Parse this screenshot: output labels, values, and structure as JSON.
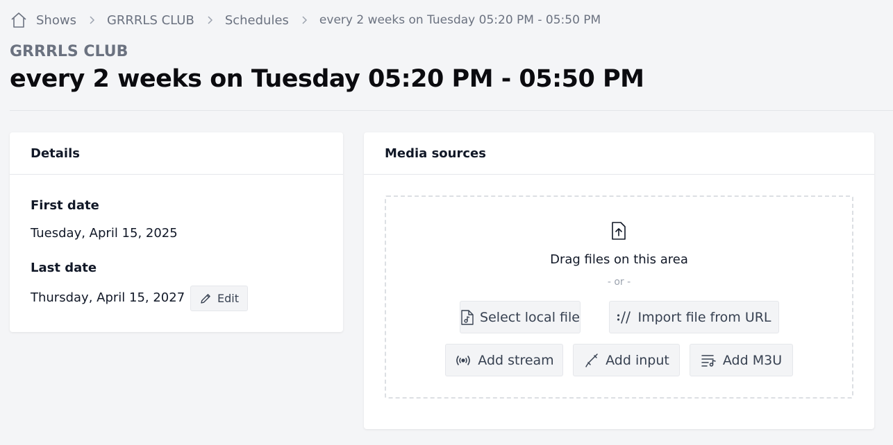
{
  "breadcrumb": {
    "items": [
      "Shows",
      "GRRRLS CLUB",
      "Schedules",
      "every 2 weeks on Tuesday 05:20 PM - 05:50 PM"
    ]
  },
  "header": {
    "show_name": "GRRRLS CLUB",
    "title": "every 2 weeks on Tuesday 05:20 PM - 05:50 PM"
  },
  "details": {
    "heading": "Details",
    "first_date_label": "First date",
    "first_date_value": "Tuesday, April 15, 2025",
    "last_date_label": "Last date",
    "last_date_value": "Thursday, April 15, 2027",
    "edit_label": "Edit"
  },
  "media": {
    "heading": "Media sources",
    "drag_text": "Drag files on this area",
    "or_text": "- or -",
    "select_local_label": "Select local file",
    "import_url_label": "Import file from URL",
    "add_stream_label": "Add stream",
    "add_input_label": "Add input",
    "add_m3u_label": "Add M3U"
  },
  "icons": {
    "home": "home-icon",
    "chevron": "chevron-right-icon",
    "upload": "file-upload-icon",
    "pencil": "pencil-icon",
    "audio_file": "audio-file-icon",
    "url": "url-slashes-icon",
    "stream": "broadcast-icon",
    "input": "audio-cable-icon",
    "playlist": "playlist-icon"
  }
}
